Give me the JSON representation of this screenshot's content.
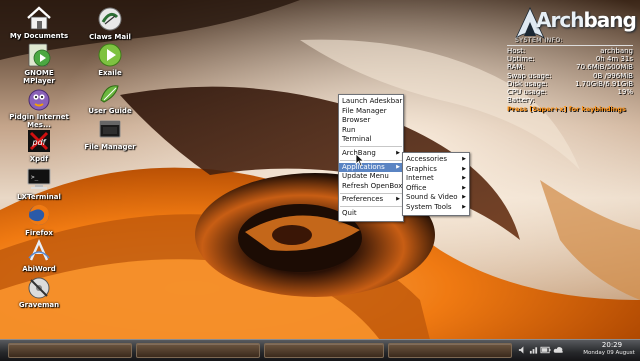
{
  "desktop_icons": [
    {
      "label": "My Documents",
      "icon": "home-folder-icon"
    },
    {
      "label": "Claws Mail",
      "icon": "claws-mail-icon"
    },
    {
      "label": "GNOME MPlayer",
      "icon": "gnome-mplayer-icon"
    },
    {
      "label": "Exaile",
      "icon": "exaile-icon"
    },
    {
      "label": "Pidgin Internet Mes...",
      "icon": "pidgin-icon"
    },
    {
      "label": "User Guide",
      "icon": "user-guide-icon"
    },
    {
      "label": "Xpdf",
      "icon": "xpdf-icon"
    },
    {
      "label": "File Manager",
      "icon": "file-manager-icon"
    },
    {
      "label": "LXTerminal",
      "icon": "terminal-icon"
    },
    {
      "label": "Firefox",
      "icon": "firefox-icon"
    },
    {
      "label": "AbiWord",
      "icon": "abiword-icon"
    },
    {
      "label": "Graveman",
      "icon": "graveman-icon"
    }
  ],
  "conky": {
    "logo_arch": "Arch",
    "logo_bang": "bang",
    "title": "SYSTEM INFO:",
    "rows": [
      {
        "label": "Host:",
        "value": "archbang"
      },
      {
        "label": "Uptime:",
        "value": "0h 4m 31s"
      },
      {
        "label": "RAM:",
        "value": "70.6MiB/500MiB"
      },
      {
        "label": "Swap usage:",
        "value": "0B  /996MiB"
      },
      {
        "label": "Disk usage:",
        "value": "1.70GiB/6.91GiB"
      },
      {
        "label": "CPU usage:",
        "value": "19%"
      },
      {
        "label": "Battery:",
        "value": ""
      }
    ],
    "hint": "Press [Super+x] for keybindings"
  },
  "root_menu": {
    "items": [
      {
        "label": "Launch Adeskbar"
      },
      {
        "label": "File Manager"
      },
      {
        "label": "Browser"
      },
      {
        "label": "Run"
      },
      {
        "label": "Terminal"
      },
      {
        "label": "ArchBang",
        "submenu": true
      },
      {
        "label": "Applications",
        "submenu": true,
        "active": true
      },
      {
        "label": "Update Menu"
      },
      {
        "label": "Refresh OpenBox"
      },
      {
        "label": "Preferences",
        "submenu": true
      },
      {
        "label": "Quit"
      }
    ],
    "arrow": "▶"
  },
  "applications_menu": {
    "items": [
      {
        "label": "Accessories"
      },
      {
        "label": "Graphics"
      },
      {
        "label": "Internet"
      },
      {
        "label": "Office"
      },
      {
        "label": "Sound & Video"
      },
      {
        "label": "System Tools"
      }
    ]
  },
  "taskbar": {
    "clock_time": "20:29",
    "clock_date": "Monday 09 August"
  },
  "colors": {
    "menu_highlight": "#5a84c3",
    "conky_hint": "#ff9418",
    "accent_orange": "#f07a12"
  }
}
